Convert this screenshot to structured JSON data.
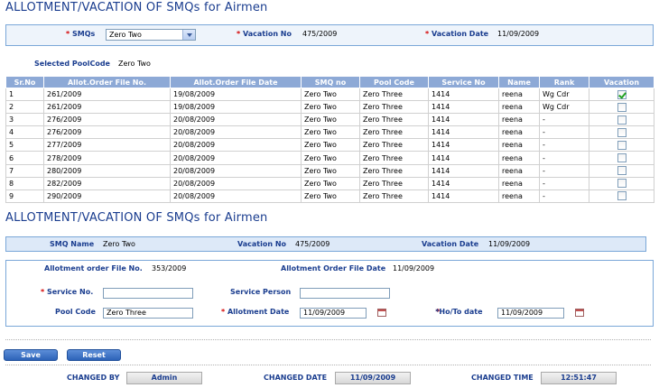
{
  "page_title": "ALLOTMENT/VACATION OF SMQs for Airmen",
  "filter": {
    "smqs_label": "SMQs",
    "smqs_value": "Zero Two",
    "vacation_no_label": "Vacation No",
    "vacation_no_value": "475/2009",
    "vacation_date_label": "Vacation Date",
    "vacation_date_value": "11/09/2009"
  },
  "selected_pool": {
    "label": "Selected PoolCode",
    "value": "Zero Two"
  },
  "table": {
    "headers": [
      "Sr.No",
      "Allot.Order File No.",
      "Allot.Order File Date",
      "SMQ no",
      "Pool Code",
      "Service No",
      "Name",
      "Rank",
      "Vacation"
    ],
    "rows": [
      {
        "sr": "1",
        "file_no": "261/2009",
        "file_date": "19/08/2009",
        "smq": "Zero Two",
        "pool": "Zero Three",
        "service": "1414",
        "name": "reena",
        "rank": "Wg Cdr",
        "vacation": true
      },
      {
        "sr": "2",
        "file_no": "261/2009",
        "file_date": "19/08/2009",
        "smq": "Zero Two",
        "pool": "Zero Three",
        "service": "1414",
        "name": "reena",
        "rank": "Wg Cdr",
        "vacation": false
      },
      {
        "sr": "3",
        "file_no": "276/2009",
        "file_date": "20/08/2009",
        "smq": "Zero Two",
        "pool": "Zero Three",
        "service": "1414",
        "name": "reena",
        "rank": "-",
        "vacation": false
      },
      {
        "sr": "4",
        "file_no": "276/2009",
        "file_date": "20/08/2009",
        "smq": "Zero Two",
        "pool": "Zero Three",
        "service": "1414",
        "name": "reena",
        "rank": "-",
        "vacation": false
      },
      {
        "sr": "5",
        "file_no": "277/2009",
        "file_date": "20/08/2009",
        "smq": "Zero Two",
        "pool": "Zero Three",
        "service": "1414",
        "name": "reena",
        "rank": "-",
        "vacation": false
      },
      {
        "sr": "6",
        "file_no": "278/2009",
        "file_date": "20/08/2009",
        "smq": "Zero Two",
        "pool": "Zero Three",
        "service": "1414",
        "name": "reena",
        "rank": "-",
        "vacation": false
      },
      {
        "sr": "7",
        "file_no": "280/2009",
        "file_date": "20/08/2009",
        "smq": "Zero Two",
        "pool": "Zero Three",
        "service": "1414",
        "name": "reena",
        "rank": "-",
        "vacation": false
      },
      {
        "sr": "8",
        "file_no": "282/2009",
        "file_date": "20/08/2009",
        "smq": "Zero Two",
        "pool": "Zero Three",
        "service": "1414",
        "name": "reena",
        "rank": "-",
        "vacation": false
      },
      {
        "sr": "9",
        "file_no": "290/2009",
        "file_date": "20/08/2009",
        "smq": "Zero Two",
        "pool": "Zero Three",
        "service": "1414",
        "name": "reena",
        "rank": "-",
        "vacation": false
      }
    ]
  },
  "section_title": "ALLOTMENT/VACATION OF SMQs for Airmen",
  "summary": {
    "smq_name_label": "SMQ Name",
    "smq_name_value": "Zero Two",
    "vacation_no_label": "Vacation No",
    "vacation_no_value": "475/2009",
    "vacation_date_label": "Vacation Date",
    "vacation_date_value": "11/09/2009"
  },
  "allotment": {
    "file_no_label": "Allotment order File No.",
    "file_no_value": "353/2009",
    "file_date_label": "Allotment Order File Date",
    "file_date_value": "11/09/2009",
    "service_no_label": "Service No.",
    "service_no_value": "",
    "service_person_label": "Service Person",
    "service_person_value": "",
    "pool_code_label": "Pool Code",
    "pool_code_value": "Zero Three",
    "allotment_date_label": "Allotment Date",
    "allotment_date_value": "11/09/2009",
    "ho_to_date_label": "*Ho/To date",
    "ho_to_date_value": "11/09/2009"
  },
  "actions": {
    "save_label": "Save",
    "reset_label": "Reset"
  },
  "footer": {
    "changed_by_label": "CHANGED BY",
    "changed_by_value": "Admin",
    "changed_date_label": "CHANGED DATE",
    "changed_date_value": "11/09/2009",
    "changed_time_label": "CHANGED TIME",
    "changed_time_value": "12:51:47"
  },
  "colors": {
    "title": "#1a3d8f",
    "required": "#d40000",
    "table_header": "#8da9d6",
    "panel_bg": "#eef4fb",
    "button": "#2d63b8"
  },
  "icons": [
    "dropdown-arrow-icon",
    "calendar-icon",
    "checkmark-icon"
  ]
}
